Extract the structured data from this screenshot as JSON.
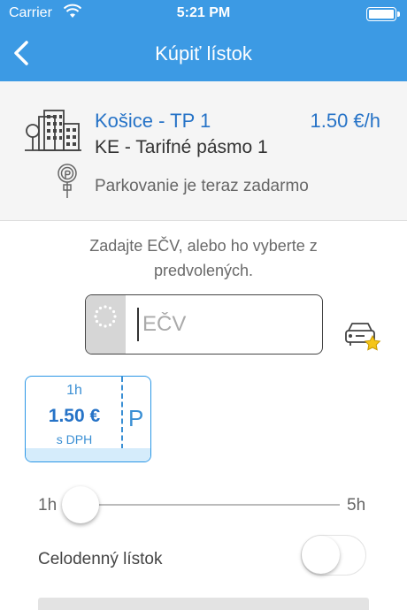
{
  "status_bar": {
    "carrier": "Carrier",
    "time": "5:21 PM"
  },
  "nav": {
    "title": "Kúpiť lístok",
    "back_icon": "chevron-left-icon"
  },
  "zone": {
    "name": "Košice - TP 1",
    "price": "1.50 €/h",
    "subtitle": "KE - Tarifné pásmo 1",
    "free_notice": "Parkovanie je teraz zadarmo"
  },
  "plate": {
    "instruction": "Zadajte EČV, alebo ho vyberte z predvolených.",
    "placeholder": "EČV"
  },
  "ticket": {
    "hours": "1h",
    "price": "1.50 €",
    "vat": "s DPH",
    "p_symbol": "P"
  },
  "duration_slider": {
    "min_label": "1h",
    "max_label": "5h",
    "value_hours": 1
  },
  "all_day": {
    "label": "Celodenný lístok",
    "enabled": false
  },
  "colors": {
    "primary": "#3c9ae4",
    "link": "#2673c7",
    "accent_star": "#f5c518"
  }
}
